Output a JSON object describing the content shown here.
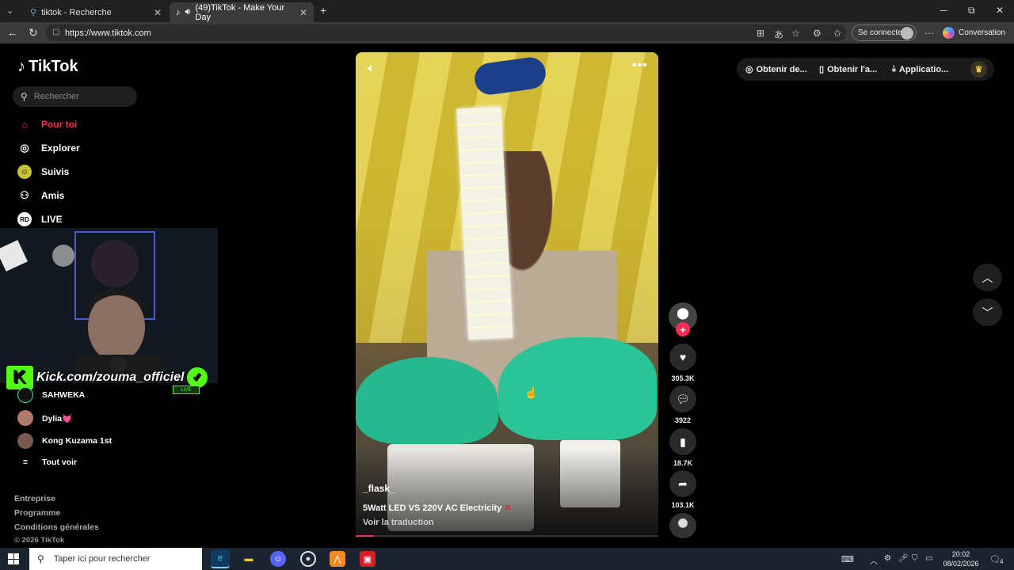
{
  "browser": {
    "tabs": [
      {
        "label": "tiktok - Recherche",
        "active": false
      },
      {
        "label": "(49)TikTok - Make Your Day",
        "active": true
      }
    ],
    "new_tab": "+",
    "url": "https://www.tiktok.com",
    "signin_label": "Se connecter",
    "conversation_label": "Conversation",
    "window_controls": {
      "minimize": "─",
      "maximize": "⧉",
      "close": "✕"
    }
  },
  "sidebar": {
    "brand": "TikTok",
    "search_placeholder": "Rechercher",
    "nav": [
      {
        "label": "Pour toi",
        "icon": "home-icon",
        "active": true
      },
      {
        "label": "Explorer",
        "icon": "compass-icon"
      },
      {
        "label": "Suivis",
        "icon": "following-icon"
      },
      {
        "label": "Amis",
        "icon": "friends-icon"
      },
      {
        "label": "LIVE",
        "icon": "live-icon"
      }
    ],
    "following": [
      {
        "name": "SAHWEKA"
      },
      {
        "name": "Dylia💓"
      },
      {
        "name": "Kong Kuzama 1st"
      }
    ],
    "see_all": "Tout voir",
    "footer": [
      "Entreprise",
      "Programme",
      "Conditions générales"
    ],
    "copyright": "© 2026 TikTok"
  },
  "overlay": {
    "kick_text": "Kick.com/zouma_officiel",
    "live_badge": "LIVE"
  },
  "video": {
    "author": "_flask_",
    "description": "5Watt LED VS 220V AC Electricity",
    "description_emoji": "✕",
    "translate": "Voir la traduction",
    "progress": 0.06
  },
  "actions": {
    "likes": "305.3K",
    "comments": "3922",
    "saves": "18.7K",
    "shares": "103.1K"
  },
  "top_right": {
    "items": [
      "Obtenir de...",
      "Obtenir l'a...",
      "Applicatio..."
    ]
  },
  "taskbar": {
    "search_placeholder": "Taper ici pour rechercher",
    "time": "20:02",
    "date": "08/02/2026",
    "notifications": "4"
  },
  "colors": {
    "accent": "#fe2c55",
    "kick": "#53fc18"
  }
}
